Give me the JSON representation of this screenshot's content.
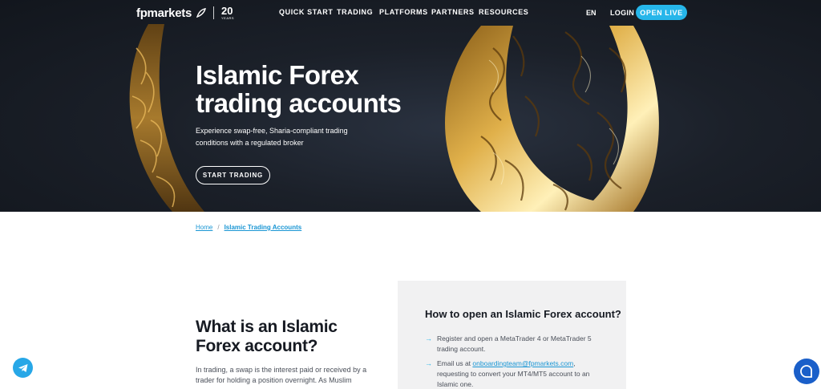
{
  "brand": {
    "name": "fpmarkets",
    "anniversary": "20",
    "anniversary_sub": "YEARS"
  },
  "nav": {
    "items": [
      {
        "label": "QUICK START"
      },
      {
        "label": "TRADING"
      },
      {
        "label": "PLATFORMS"
      },
      {
        "label": "PARTNERS"
      },
      {
        "label": "RESOURCES"
      }
    ],
    "language": "EN",
    "login": "LOGIN",
    "open_live": "OPEN LIVE"
  },
  "hero": {
    "title": "Islamic Forex trading accounts",
    "subtitle": "Experience swap-free, Sharia-compliant trading conditions with a regulated broker",
    "cta": "START TRADING"
  },
  "breadcrumb": {
    "home": "Home",
    "separator": "/",
    "current": "Islamic Trading Accounts"
  },
  "what_is": {
    "title": "What is an Islamic Forex account?",
    "body": "In trading, a swap is the interest paid or received by a trader for holding a position overnight. As Muslim"
  },
  "how_to": {
    "title": "How to open an Islamic Forex account?",
    "step1": "Register and open a MetaTrader 4 or MetaTrader 5 trading account.",
    "step2_before": "Email us at ",
    "step2_email": "onboardingteam@fpmarkets.com",
    "step2_after": ", requesting to convert your MT4/MT5 account to an Islamic one.",
    "arrow": "→"
  },
  "colors": {
    "accent": "#26b6ea",
    "link": "#1a96d4",
    "hero_bg": "#1b2029",
    "gold": "#c9962f",
    "chat": "#1a5fc9"
  },
  "icons": {
    "telegram": "telegram-icon",
    "chat": "chat-bubble-icon"
  }
}
